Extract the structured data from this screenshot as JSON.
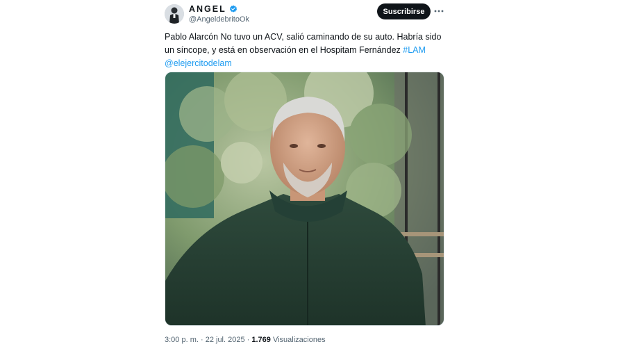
{
  "author": {
    "name": "ANGEL",
    "handle": "@AngeldebritoOk",
    "verified": true,
    "verified_color": "#1d9bf0",
    "avatar_icon": "person-avatar-icon"
  },
  "actions": {
    "subscribe_label": "Suscribirse",
    "more_icon": "more-horizontal-icon"
  },
  "tweet": {
    "text": "Pablo Alarcón No tuvo un ACV, salió caminando de su auto. Habría sido un síncope, y está en observación en el Hospitam Fernández ",
    "hashtag": "#LAM",
    "mention": "@elejercitodelam",
    "link_color": "#1d9bf0"
  },
  "media": {
    "kind": "photo",
    "alt": "photo-elderly-man-green-sweater"
  },
  "meta": {
    "time": "3:00 p. m.",
    "separator": " · ",
    "date": "22 jul. 2025",
    "separator2": " · ",
    "views_count": "1.769",
    "views_label": " Visualizaciones"
  }
}
